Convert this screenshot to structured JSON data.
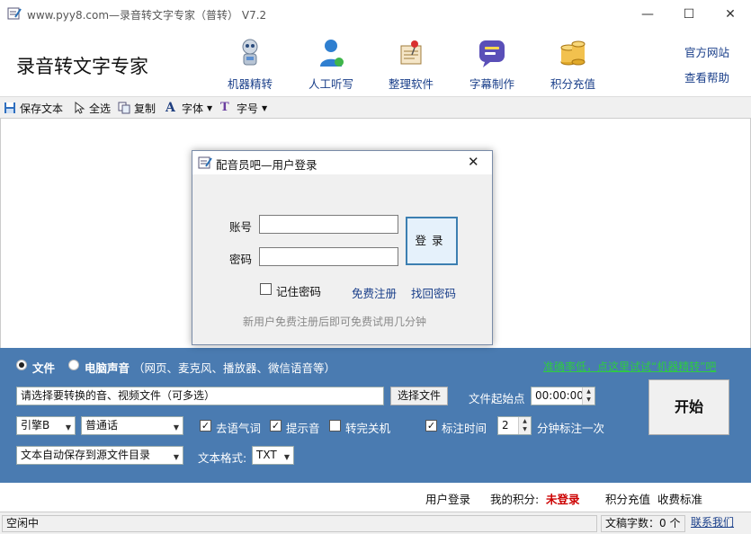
{
  "window": {
    "title": "www.pyy8.com—录音转文字专家（普转） V7.2",
    "min": "—",
    "max": "☐",
    "close": "✕"
  },
  "header": {
    "brand": "录音转文字专家",
    "nav": [
      {
        "label": "机器精转",
        "icon": "robot-icon"
      },
      {
        "label": "人工听写",
        "icon": "person-headset-icon"
      },
      {
        "label": "整理软件",
        "icon": "notepad-pin-icon"
      },
      {
        "label": "字幕制作",
        "icon": "chat-bubble-icon"
      },
      {
        "label": "积分充值",
        "icon": "coins-icon"
      }
    ],
    "official_site": "官方网站",
    "help": "查看帮助"
  },
  "toolbar": {
    "save": "保存文本",
    "select_all": "全选",
    "copy": "复制",
    "font": "字体",
    "font_size": "字号"
  },
  "dialog": {
    "title": "配音员吧—用户登录",
    "account_label": "账号",
    "password_label": "密码",
    "account_value": "",
    "password_value": "",
    "login_button": "登录",
    "remember": "记住密码",
    "register": "免费注册",
    "recover": "找回密码",
    "hint": "新用户免费注册后即可免费试用几分钟"
  },
  "panel": {
    "source_file": "文件",
    "source_pc": "电脑声音",
    "source_pc_note": "（网页、麦克风、播放器、微信语音等）",
    "promo_link": "准确率低，点这里试试“机器精转”吧",
    "file_placeholder": "请选择要转换的音、视频文件（可多选）",
    "choose_file": "选择文件",
    "start_point_label": "文件起始点",
    "start_point_value": "00:00:00",
    "start": "开始",
    "engine": "引擎B",
    "language": "普通话",
    "opt_breath": "去语气词",
    "opt_beep": "提示音",
    "opt_shutdown": "转完关机",
    "opt_timestamp": "标注时间",
    "interval_value": "2",
    "interval_suffix": "分钟标注一次",
    "save_mode": "文本自动保存到源文件目录",
    "format_label": "文本格式:",
    "format_value": "TXT"
  },
  "bottom": {
    "user_login": "用户登录",
    "my_points": "我的积分:",
    "points_status": "未登录",
    "recharge": "积分充值",
    "pricing": "收费标准"
  },
  "status": {
    "state": "空闲中",
    "word_count": "文稿字数：0 个",
    "contact": "联系我们"
  },
  "colors": {
    "panel_blue": "#4a7bb1",
    "link_blue": "#1a3f8a",
    "promo_green": "#2ecc40",
    "status_red": "#cc0000"
  }
}
